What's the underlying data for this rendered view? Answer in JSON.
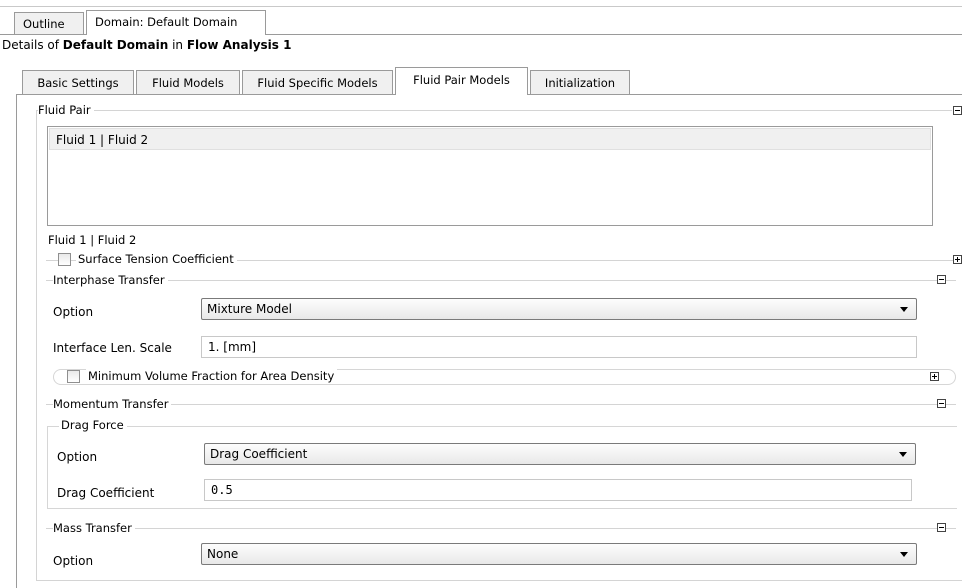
{
  "top_tabs": [
    {
      "label": "Outline"
    },
    {
      "label": "Domain: Default Domain"
    }
  ],
  "details": {
    "prefix": "Details of ",
    "object": "Default Domain",
    "middle": " in ",
    "parent": "Flow Analysis 1"
  },
  "sub_tabs": [
    {
      "label": "Basic Settings"
    },
    {
      "label": "Fluid Models"
    },
    {
      "label": "Fluid Specific Models"
    },
    {
      "label": "Fluid Pair Models"
    },
    {
      "label": "Initialization"
    }
  ],
  "fluid_pair": {
    "title": "Fluid Pair",
    "items": [
      "Fluid 1 | Fluid 2"
    ]
  },
  "pair_section": {
    "title": "Fluid 1 | Fluid 2",
    "surface_tension_label": "Surface Tension Coefficient",
    "surface_tension_checked": false
  },
  "interphase": {
    "title": "Interphase Transfer",
    "option_label": "Option",
    "option_value": "Mixture Model",
    "len_scale_label": "Interface Len. Scale",
    "len_scale_value": "1. [mm]",
    "min_vol_label": "Minimum Volume Fraction for Area Density",
    "min_vol_checked": false
  },
  "momentum": {
    "title": "Momentum Transfer",
    "drag_title": "Drag Force",
    "option_label": "Option",
    "option_value": "Drag Coefficient",
    "coef_label": "Drag Coefficient",
    "coef_value": "0.5"
  },
  "mass": {
    "title": "Mass Transfer",
    "option_label": "Option",
    "option_value": "None"
  }
}
